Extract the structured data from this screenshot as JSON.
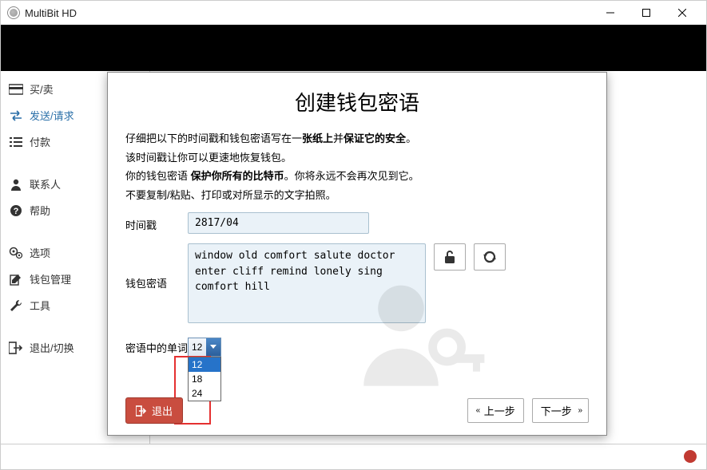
{
  "window": {
    "title": "MultiBit HD"
  },
  "sidebar": {
    "items": [
      {
        "label": "买/卖",
        "icon": "card"
      },
      {
        "label": "发送/请求",
        "icon": "swap"
      },
      {
        "label": "付款",
        "icon": "list"
      },
      {
        "label": "联系人",
        "icon": "user"
      },
      {
        "label": "帮助",
        "icon": "question"
      },
      {
        "label": "选项",
        "icon": "gears"
      },
      {
        "label": "钱包管理",
        "icon": "edit"
      },
      {
        "label": "工具",
        "icon": "wrench"
      },
      {
        "label": "退出/切换",
        "icon": "signout"
      }
    ]
  },
  "modal": {
    "title": "创建钱包密语",
    "line1_a": "仔细把以下的时间戳和钱包密语写在一",
    "line1_b": "张纸上",
    "line1_c": "并",
    "line1_d": "保证它的安全",
    "line1_e": "。",
    "line2": "该时间戳让你可以更速地恢复钱包。",
    "line3_a": "你的钱包密语 ",
    "line3_b": "保护你所有的比特币",
    "line3_c": "。你将永远不会再次见到它。",
    "line4": "不要复制/粘贴、打印或对所显示的文字拍照。",
    "label_timestamp": "时间戳",
    "timestamp_value": "2817/04",
    "label_words": "钱包密语",
    "words_value": "window old comfort salute doctor enter cliff remind lonely sing comfort hill",
    "label_count": "密语中的单词",
    "select_value": "12",
    "options": [
      "12",
      "18",
      "24"
    ],
    "exit": "退出",
    "prev": "上一步",
    "next": "下一步"
  }
}
